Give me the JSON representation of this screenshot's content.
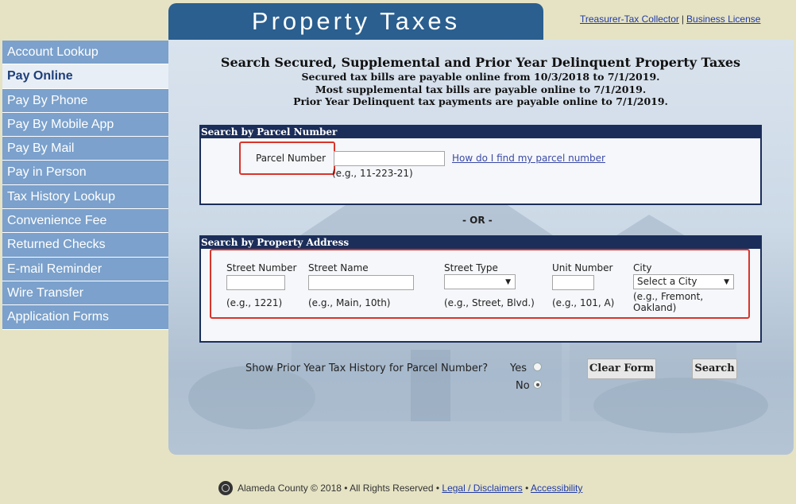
{
  "header": {
    "title": "Property Taxes",
    "links": [
      "Treasurer-Tax Collector",
      "Business License"
    ]
  },
  "sidebar": {
    "items": [
      {
        "label": "Account Lookup",
        "active": false
      },
      {
        "label": "Pay Online",
        "active": true
      },
      {
        "label": "Pay By Phone",
        "active": false
      },
      {
        "label": "Pay By Mobile App",
        "active": false
      },
      {
        "label": "Pay By Mail",
        "active": false
      },
      {
        "label": "Pay in Person",
        "active": false
      },
      {
        "label": "Tax History Lookup",
        "active": false
      },
      {
        "label": "Convenience Fee",
        "active": false
      },
      {
        "label": "Returned Checks",
        "active": false
      },
      {
        "label": "E-mail Reminder",
        "active": false
      },
      {
        "label": "Wire Transfer",
        "active": false
      },
      {
        "label": "Application Forms",
        "active": false
      }
    ]
  },
  "main": {
    "heading": "Search Secured, Supplemental and Prior Year Delinquent Property Taxes",
    "subheadings": [
      "Secured tax bills are payable online from 10/3/2018 to 7/1/2019.",
      "Most supplemental tax bills are payable online to 7/1/2019.",
      "Prior Year Delinquent tax payments are payable online to 7/1/2019."
    ],
    "parcel_search": {
      "title": "Search by Parcel Number",
      "label": "Parcel Number",
      "value": "",
      "example": "(e.g., 11-223-21)",
      "help_link": "How do I find my parcel number"
    },
    "or_text": "- OR -",
    "address_search": {
      "title": "Search by Property Address",
      "street_number": {
        "label": "Street Number",
        "value": "",
        "example": "(e.g., 1221)"
      },
      "street_name": {
        "label": "Street Name",
        "value": "",
        "example": "(e.g., Main, 10th)"
      },
      "street_type": {
        "label": "Street Type",
        "value": "",
        "example": "(e.g., Street, Blvd.)"
      },
      "unit_number": {
        "label": "Unit Number",
        "value": "",
        "example": "(e.g., 101, A)"
      },
      "city": {
        "label": "City",
        "value": "Select a City",
        "example_line1": "(e.g., Fremont,",
        "example_line2": "Oakland)"
      }
    },
    "history": {
      "question": "Show Prior Year Tax History for Parcel Number?",
      "yes_label": "Yes",
      "no_label": "No",
      "selected": "No"
    },
    "buttons": {
      "clear": "Clear Form",
      "search": "Search"
    }
  },
  "footer": {
    "text": "Alameda County © 2018 • All Rights Reserved •",
    "sep": "•",
    "links": [
      "Legal / Disclaimers",
      "Accessibility"
    ]
  },
  "colors": {
    "sidebar": "#7ba1cc",
    "sidebar_active": "#e8eef5",
    "title_tab": "#2a5f8f",
    "box_border": "#1b2e5a",
    "highlight": "#d9342b",
    "page_bg": "#e6e3c4"
  }
}
